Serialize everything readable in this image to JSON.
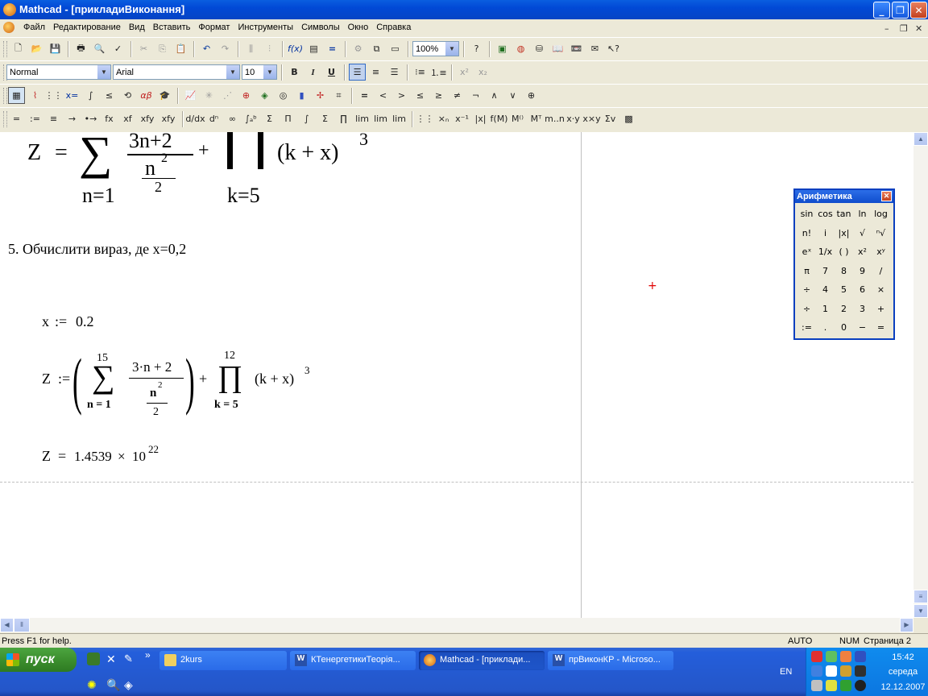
{
  "window": {
    "title": "Mathcad - [прикладиВиконання]"
  },
  "menu": [
    "Файл",
    "Редактирование",
    "Вид",
    "Вставить",
    "Формат",
    "Инструменты",
    "Символы",
    "Окно",
    "Справка"
  ],
  "toolbar": {
    "zoom": "100%"
  },
  "format_bar": {
    "style": "Normal",
    "font": "Arial",
    "size": "10"
  },
  "math_toolbar": {
    "row1_ops": [
      "=",
      "<",
      ">",
      "≤",
      "≥",
      "≠",
      "¬",
      "∧",
      "∨",
      "⊕"
    ],
    "row2_ops": [
      "=",
      ":=",
      "≡",
      "→",
      "•→",
      "fx",
      "xf",
      "xfy",
      "xfy"
    ]
  },
  "document": {
    "top_formula": {
      "lhs": "Z",
      "eq": "=",
      "num": "3n+2",
      "den_base": "n",
      "den_exp": "2",
      "den_div": "2",
      "lower_sum": "n=1",
      "plus": "+",
      "factor": "(k + x)",
      "exp": "3",
      "lower_prod": "k=5"
    },
    "task_text": "5. Обчислити вираз, де x=0,2",
    "x_def": {
      "lhs": "x",
      "op": ":=",
      "value": "0.2"
    },
    "z_def": {
      "lhs": "Z",
      "op": ":=",
      "sum_upper": "15",
      "sum_lower": "n = 1",
      "num": "3·n + 2",
      "den_base": "n",
      "den_exp": "2",
      "den_div": "2",
      "plus": "+",
      "prod_upper": "12",
      "prod_lower": "k = 5",
      "factor": "(k + x)",
      "exp": "3"
    },
    "z_result": {
      "lhs": "Z",
      "op": "=",
      "mantissa": "1.4539",
      "times": "×",
      "base": "10",
      "exp": "22"
    }
  },
  "palette": {
    "title": "Арифметика",
    "buttons": [
      "sin",
      "cos",
      "tan",
      "ln",
      "log",
      "n!",
      "i",
      "|x|",
      "√",
      "ⁿ√",
      "eˣ",
      "1/x",
      "( )",
      "x²",
      "xʸ",
      "π",
      "7",
      "8",
      "9",
      "/",
      "÷",
      "4",
      "5",
      "6",
      "×",
      "÷",
      "1",
      "2",
      "3",
      "+",
      ":=",
      ".",
      "0",
      "−",
      "="
    ]
  },
  "status": {
    "help": "Press F1 for help.",
    "auto": "AUTO",
    "num": "NUM",
    "page": "Страница 2"
  },
  "taskbar": {
    "start": "пуск",
    "tasks": [
      "2kurs",
      "КТенергетикиТеорія...",
      "Mathcad - [приклади...",
      "прВиконКР - Microso..."
    ],
    "lang": "EN",
    "time": "15:42",
    "day": "середа",
    "date": "12.12.2007"
  }
}
